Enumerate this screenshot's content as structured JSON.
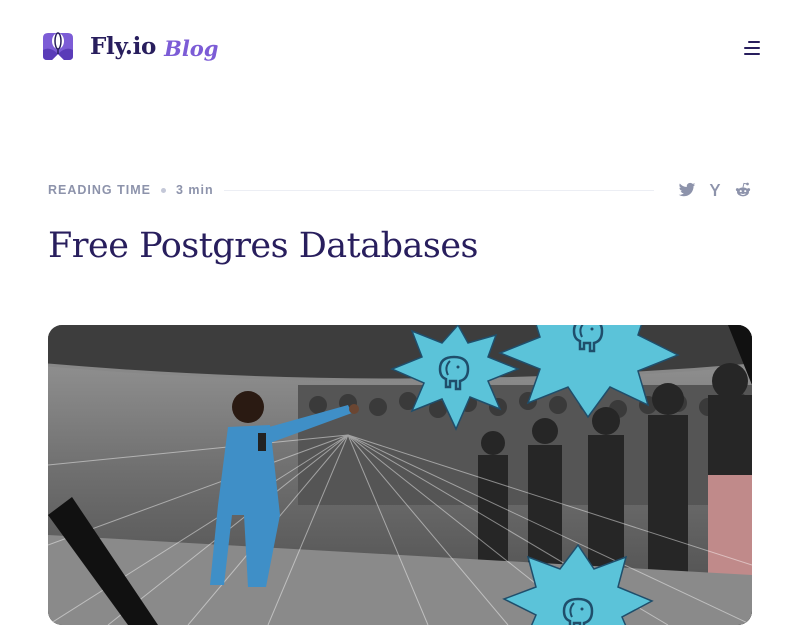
{
  "header": {
    "brand": "Fly.io",
    "section": "Blog",
    "logo_icon": "balloon-logo-icon",
    "menu_icon": "hamburger-menu-icon"
  },
  "meta": {
    "reading_label": "Reading time",
    "reading_value": "3 min",
    "share_icons": [
      "twitter-icon",
      "hacker-news-icon",
      "reddit-icon"
    ]
  },
  "article": {
    "title": "Free Postgres Databases",
    "hero_image_icon": "postgres-elephant-icon"
  },
  "colors": {
    "heading": "#281e5d",
    "accent": "#7c5cd6",
    "meta": "#8d93ab",
    "starburst": "#5bc3d9"
  }
}
